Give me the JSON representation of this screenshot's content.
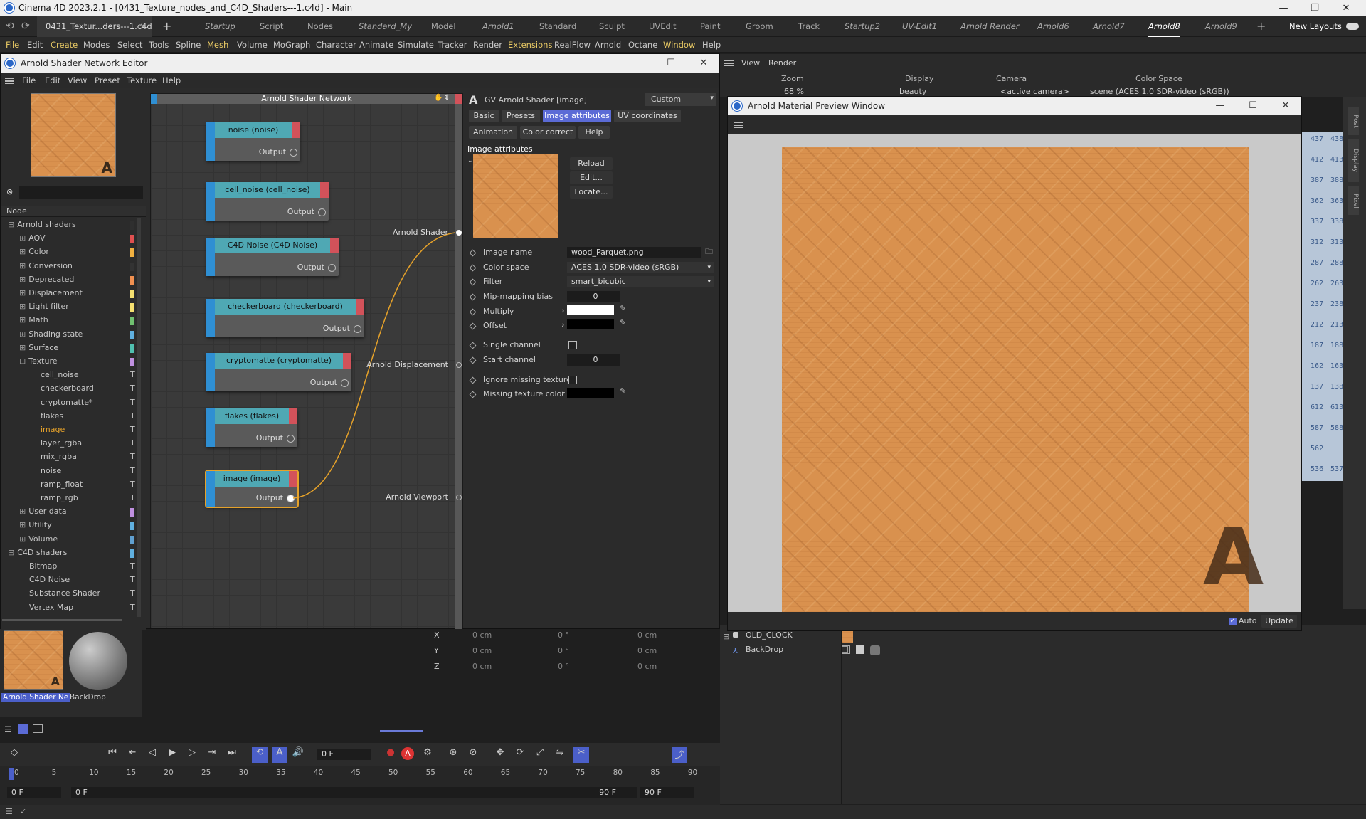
{
  "app": {
    "title": "Cinema 4D 2023.2.1 - [0431_Texture_nodes_and_C4D_Shaders---1.c4d] - Main"
  },
  "doc_tab": "0431_Textur...ders---1.c4d",
  "layouts": [
    "Startup",
    "Script",
    "Nodes",
    "Standard_My",
    "Model",
    "Arnold1",
    "Standard",
    "Sculpt",
    "UVEdit",
    "Paint",
    "Groom",
    "Track",
    "Startup2",
    "UV-Edit1",
    "Arnold Render",
    "Arnold6",
    "Arnold7",
    "Arnold8",
    "Arnold9"
  ],
  "layouts_active": "Arnold8",
  "new_layouts": "New Layouts",
  "main_menu": [
    "File",
    "Edit",
    "Create",
    "Modes",
    "Select",
    "Tools",
    "Spline",
    "Mesh",
    "Volume",
    "MoGraph",
    "Character",
    "Animate",
    "Simulate",
    "Tracker",
    "Render",
    "Extensions",
    "RealFlow",
    "Arnold",
    "Octane",
    "Window",
    "Help"
  ],
  "editor": {
    "title": "Arnold Shader Network Editor",
    "menu": [
      "File",
      "Edit",
      "View",
      "Preset",
      "Texture",
      "Help"
    ],
    "tree_header": "Node",
    "tree": {
      "root": "Arnold shaders",
      "groups": [
        "AOV",
        "Color",
        "Conversion",
        "Deprecated",
        "Displacement",
        "Light filter",
        "Math",
        "Shading state",
        "Surface",
        "Texture"
      ],
      "texture_items": [
        "cell_noise",
        "checkerboard",
        "cryptomatte*",
        "flakes",
        "image",
        "layer_rgba",
        "mix_rgba",
        "noise",
        "ramp_float",
        "ramp_rgb"
      ],
      "after": [
        "User data",
        "Utility",
        "Volume"
      ],
      "c4d_root": "C4D shaders",
      "c4d_items": [
        "Bitmap",
        "C4D Noise",
        "Substance Shader",
        "Vertex Map"
      ]
    },
    "type_marker": "T",
    "network": {
      "title": "Arnold Shader Network",
      "nodes": [
        "noise (noise)",
        "cell_noise (cell_noise)",
        "C4D Noise (C4D Noise)",
        "checkerboard (checkerboard)",
        "cryptomatte (cryptomatte)",
        "flakes (flakes)",
        "image (image)"
      ],
      "output_label": "Output",
      "root_ports": [
        "Arnold Shader",
        "Arnold Displacement",
        "Arnold Viewport"
      ]
    },
    "attr": {
      "header": "GV Arnold Shader [image]",
      "preset": "Custom",
      "tabs": [
        "Basic",
        "Presets",
        "Image attributes",
        "UV coordinates",
        "Animation",
        "Color correct",
        "Help"
      ],
      "section": "Image attributes",
      "buttons": [
        "Reload",
        "Edit...",
        "Locate..."
      ],
      "image_name_label": "Image name",
      "image_name": "wood_Parquet.png",
      "color_space_label": "Color space",
      "color_space": "ACES 1.0 SDR-video (sRGB)",
      "filter_label": "Filter",
      "filter": "smart_bicubic",
      "mip_label": "Mip-mapping bias",
      "mip": "0",
      "multiply_label": "Multiply",
      "offset_label": "Offset",
      "single_channel_label": "Single channel",
      "start_channel_label": "Start channel",
      "start_channel": "0",
      "ignore_missing_label": "Ignore missing textures",
      "missing_color_label": "Missing texture color"
    }
  },
  "viewport_bar": {
    "view": "View",
    "render": "Render",
    "zoom_label": "Zoom",
    "zoom": "68 %",
    "display_label": "Display",
    "display": "beauty",
    "camera_label": "Camera",
    "camera": "<active camera>",
    "cs_label": "Color Space",
    "cs": "scene (ACES 1.0 SDR-video (sRGB))"
  },
  "side_tabs": [
    "Post",
    "Display",
    "Pixel"
  ],
  "numbers_col1": [
    "437",
    "412",
    "387",
    "362",
    "337",
    "312",
    "287",
    "262",
    "237",
    "212",
    "187",
    "162",
    "137",
    "612",
    "587",
    "562",
    "536"
  ],
  "numbers_col2": [
    "438",
    "413",
    "388",
    "363",
    "338",
    "313",
    "288",
    "263",
    "238",
    "213",
    "188",
    "163",
    "138",
    "613",
    "588",
    "",
    "537"
  ],
  "preview": {
    "title": "Arnold Material Preview Window",
    "auto": "Auto",
    "update": "Update"
  },
  "objects": [
    "OLD_CLOCK",
    "BackDrop"
  ],
  "materials": [
    {
      "name": "Arnold Shader Ne"
    },
    {
      "name": "BackDrop"
    }
  ],
  "coords": {
    "x": "X",
    "y": "Y",
    "z": "Z",
    "cm": "0 cm",
    "deg": "0 °"
  },
  "timeline": {
    "frame": "0 F",
    "ticks": [
      "0",
      "5",
      "10",
      "15",
      "20",
      "25",
      "30",
      "35",
      "40",
      "45",
      "50",
      "55",
      "60",
      "65",
      "70",
      "75",
      "80",
      "85",
      "90"
    ],
    "start": "0 F",
    "start2": "0 F",
    "end": "90 F",
    "end2": "90 F"
  }
}
